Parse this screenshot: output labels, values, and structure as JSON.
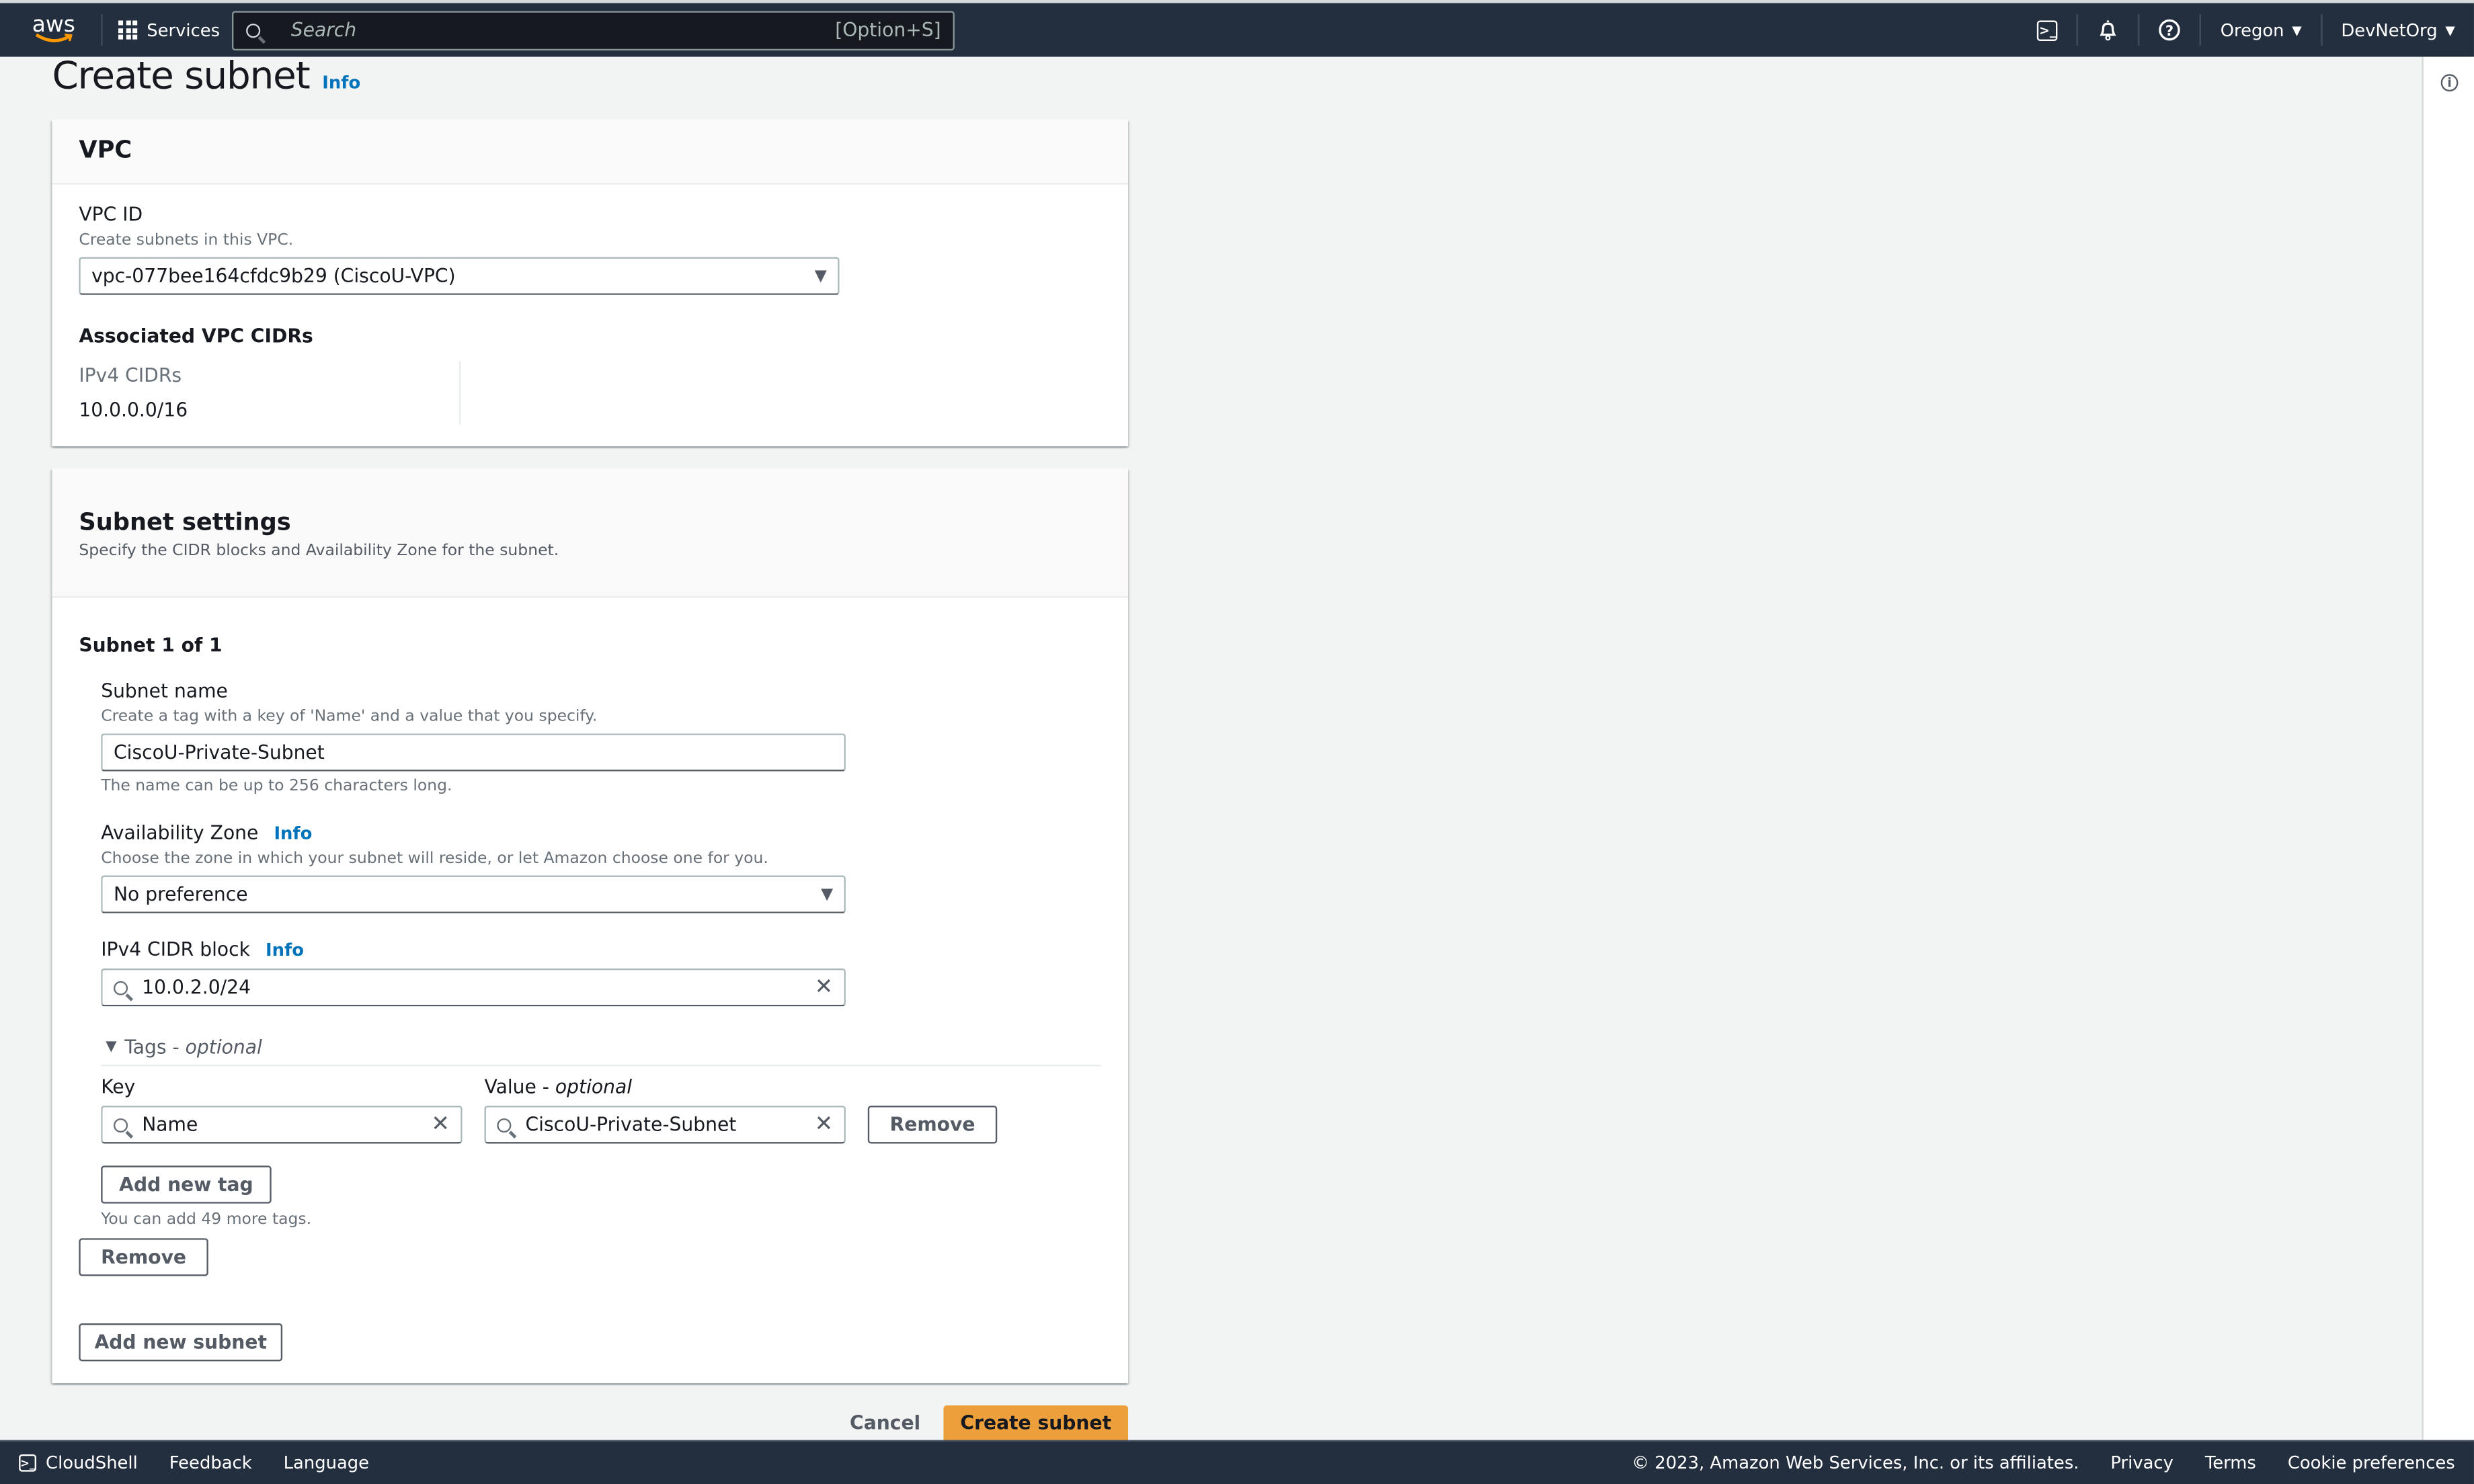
{
  "topnav": {
    "logo_text": "aws",
    "services_label": "Services",
    "search_placeholder": "Search",
    "search_shortcut": "[Option+S]",
    "region": "Oregon",
    "account": "DevNetOrg"
  },
  "page": {
    "title": "Create subnet",
    "info_label": "Info"
  },
  "vpc": {
    "heading": "VPC",
    "vpc_id_label": "VPC ID",
    "vpc_id_help": "Create subnets in this VPC.",
    "vpc_id_value": "vpc-077bee164cfdc9b29 (CiscoU-VPC)",
    "cidrs_heading": "Associated VPC CIDRs",
    "ipv4_label": "IPv4 CIDRs",
    "ipv4_value": "10.0.0.0/16"
  },
  "subnet_settings": {
    "heading": "Subnet settings",
    "description": "Specify the CIDR blocks and Availability Zone for the subnet.",
    "subnet_counter": "Subnet 1 of 1",
    "name_label": "Subnet name",
    "name_help": "Create a tag with a key of 'Name' and a value that you specify.",
    "name_value": "CiscoU-Private-Subnet",
    "name_constraint": "The name can be up to 256 characters long.",
    "az_label": "Availability Zone",
    "az_info": "Info",
    "az_help": "Choose the zone in which your subnet will reside, or let Amazon choose one for you.",
    "az_value": "No preference",
    "cidr_label": "IPv4 CIDR block",
    "cidr_info": "Info",
    "cidr_value": "10.0.2.0/24",
    "tags_label": "Tags",
    "tags_optional": "optional",
    "key_label": "Key",
    "value_label": "Value",
    "value_optional": "optional",
    "tags": [
      {
        "key": "Name",
        "value": "CiscoU-Private-Subnet"
      }
    ],
    "remove_tag_label": "Remove",
    "add_tag_label": "Add new tag",
    "tags_remaining": "You can add 49 more tags.",
    "remove_subnet_label": "Remove",
    "add_subnet_label": "Add new subnet"
  },
  "actions": {
    "cancel": "Cancel",
    "create": "Create subnet"
  },
  "footer": {
    "cloudshell": "CloudShell",
    "feedback": "Feedback",
    "language": "Language",
    "copyright": "© 2023, Amazon Web Services, Inc. or its affiliates.",
    "privacy": "Privacy",
    "terms": "Terms",
    "cookies": "Cookie preferences"
  },
  "colors": {
    "nav_bg": "#232f3e",
    "primary_button": "#ec9f3a",
    "link": "#0073bb",
    "page_bg": "#f2f3f3"
  }
}
